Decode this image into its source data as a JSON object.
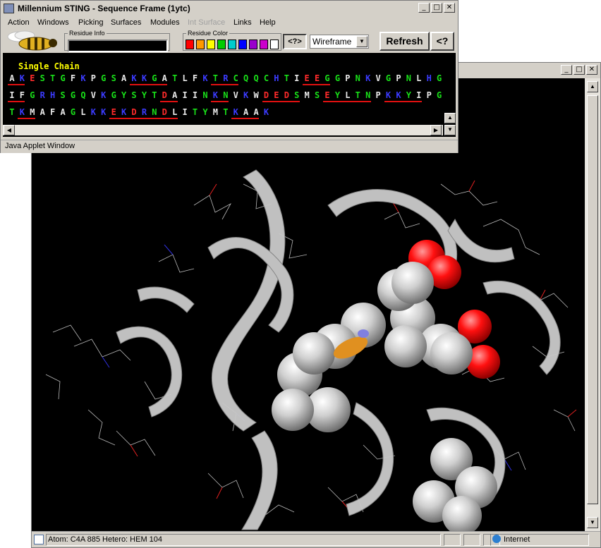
{
  "seq_window": {
    "title": "Millennium STING - Sequence Frame (1ytc)",
    "menu": [
      "Action",
      "Windows",
      "Picking",
      "Surfaces",
      "Modules",
      "Int Surface",
      "Links",
      "Help"
    ],
    "menu_disabled": [
      "Int Surface"
    ],
    "residue_info_label": "Residue Info",
    "residue_info_value": "",
    "residue_color_label": "Residue Color",
    "color_swatches": [
      "#ff0000",
      "#ff9900",
      "#ffff00",
      "#00cc00",
      "#00cccc",
      "#0000ff",
      "#9900cc",
      "#cc00cc",
      "#ffffff"
    ],
    "help_small": "<?>",
    "render_mode": "Wireframe",
    "refresh": "Refresh",
    "help_big": "<?",
    "chain_title": "Single Chain",
    "sequence_lines": [
      "AKESTGFKPGSAKKGATLFKTRCQQCHTIEEGGPNKVGPNLHG",
      "IFGRHSGQVKGYSYTDAIINKNVKWDEDSMSEYLTNPKKYIPG",
      "TKMAFAGLKKEKDRNDLITYMTKAAK"
    ],
    "applet_status": "Java Applet Window"
  },
  "viewer_window": {
    "status_text": "Atom: C4A 885  Hetero: HEM 104",
    "zone": "Internet"
  },
  "icons": {
    "app": "java-app-icon",
    "bee": "bee-logo-icon",
    "minimize": "minimize-icon",
    "maximize": "maximize-icon",
    "close": "close-icon",
    "globe": "globe-icon",
    "page": "page-icon"
  }
}
